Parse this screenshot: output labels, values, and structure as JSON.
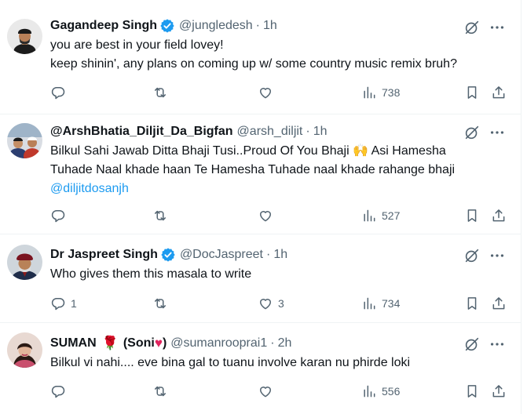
{
  "colors": {
    "text": "#0f1419",
    "secondary": "#536471",
    "link": "#1d9bf0",
    "verified": "#1d9bf0",
    "divider": "#eff3f4"
  },
  "tweets": [
    {
      "name": "Gagandeep Singh",
      "verified": true,
      "handle": "@jungledesh",
      "dot": "·",
      "time": "1h",
      "lines": [
        "you are best in your field lovey!",
        "keep shinin', any plans on coming up w/ some country music remix bruh?"
      ],
      "replies": "",
      "retweets": "",
      "likes": "",
      "views": "738"
    },
    {
      "name": "@ArshBhatia_Diljit_Da_Bigfan",
      "verified": false,
      "handle": "@arsh_diljit",
      "dot": "·",
      "time": "1h",
      "lines": [
        "Bilkul Sahi Jawab Ditta Bhaji Tusi..Proud Of You Bhaji 🙌 Asi Hamesha",
        "Tuhade Naal khade haan Te Hamesha Tuhade naal khade rahange bhaji"
      ],
      "mention": "@diljitdosanjh",
      "replies": "",
      "retweets": "",
      "likes": "",
      "views": "527"
    },
    {
      "name": "Dr Jaspreet Singh",
      "verified": true,
      "handle": "@DocJaspreet",
      "dot": "·",
      "time": "1h",
      "lines": [
        "Who gives them this masala to write"
      ],
      "replies": "1",
      "retweets": "",
      "likes": "3",
      "views": "734"
    },
    {
      "name": "SUMAN",
      "name_rose": "🌹",
      "name_paren_open": "(Soni",
      "name_heart": "♥",
      "name_paren_close": ")",
      "verified": false,
      "handle": "@sumanrooprai1",
      "dot": "·",
      "time": "2h",
      "lines": [
        "Bilkul vi nahi.... eve bina gal to tuanu involve karan nu phirde loki"
      ],
      "replies": "",
      "retweets": "",
      "likes": "",
      "views": "556"
    }
  ]
}
